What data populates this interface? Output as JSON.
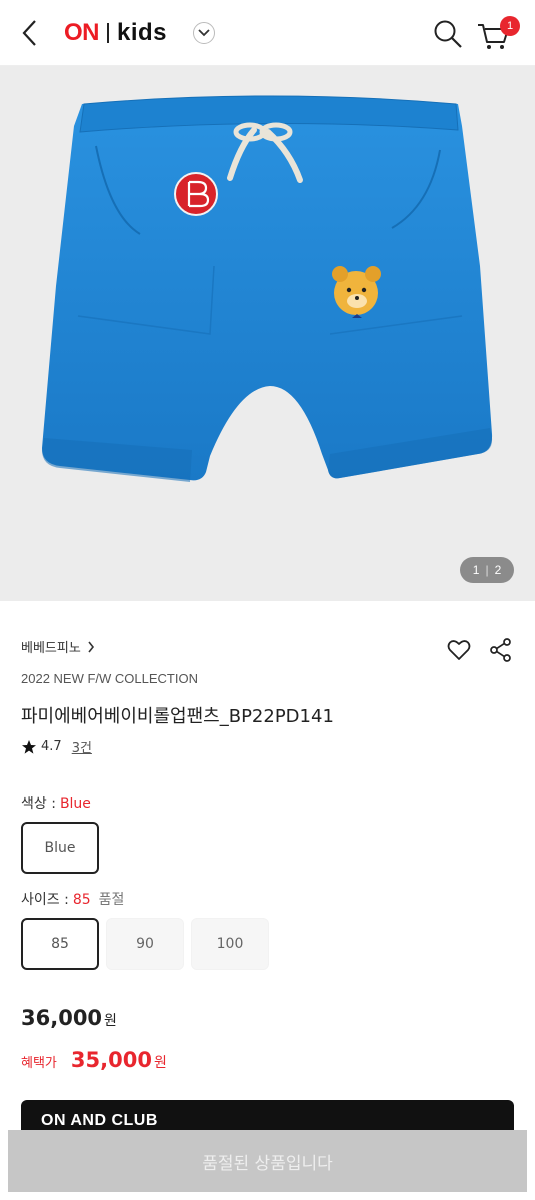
{
  "header": {
    "logo_on": "ON",
    "logo_kids": "kids",
    "cart_count": "1"
  },
  "gallery": {
    "current": "1",
    "total": "2",
    "separator": "|"
  },
  "product": {
    "brand": "베베드피노",
    "collection": "2022 NEW F/W COLLECTION",
    "name": "파미에베어베이비롤업팬츠_BP22PD141",
    "rating": "4.7",
    "review_count": "3건"
  },
  "options": {
    "color_label": "색상 :",
    "color_value": "Blue",
    "color_choices": [
      "Blue"
    ],
    "size_label": "사이즈 :",
    "size_value": "85",
    "size_status": "품절",
    "size_choices": [
      "85",
      "90",
      "100"
    ]
  },
  "pricing": {
    "price": "36,000",
    "currency": "원",
    "sale_label": "혜택가",
    "sale_price": "35,000"
  },
  "banner": {
    "text": "ON AND CLUB"
  },
  "cta": {
    "label": "품절된 상품입니다"
  },
  "colors": {
    "accent": "#e8262e",
    "product_blue": "#1f87d6"
  },
  "icons": [
    "back-icon",
    "chevron-down-icon",
    "search-icon",
    "cart-icon",
    "heart-icon",
    "share-icon",
    "star-icon",
    "chevron-right-icon"
  ]
}
